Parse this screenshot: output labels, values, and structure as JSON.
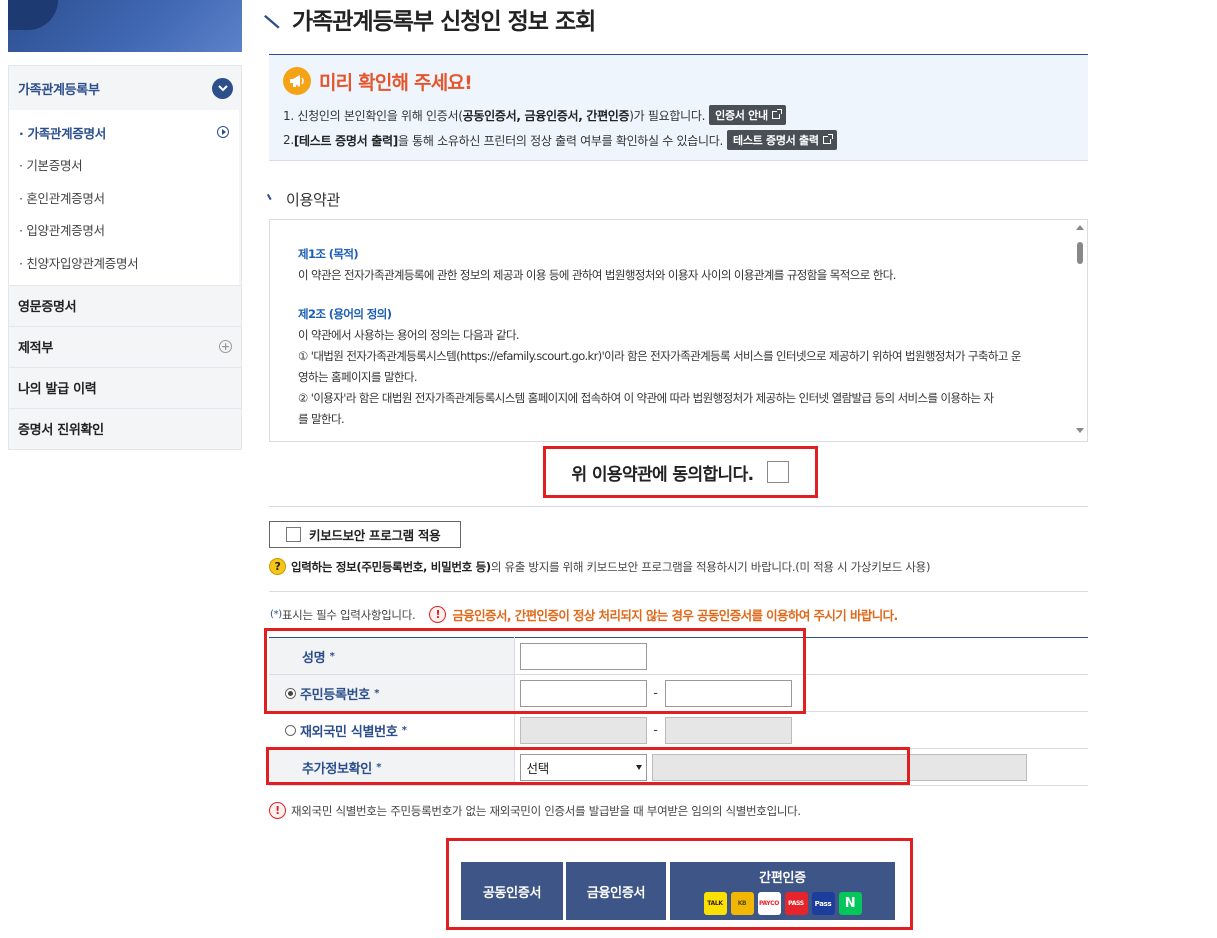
{
  "sidebar": {
    "section_title": "가족관계등록부",
    "sub_items": [
      {
        "label": "가족관계증명서"
      },
      {
        "label": "기본증명서"
      },
      {
        "label": "혼인관계증명서"
      },
      {
        "label": "입양관계증명서"
      },
      {
        "label": "친양자입양관계증명서"
      }
    ],
    "items": [
      {
        "label": "영문증명서"
      },
      {
        "label": "제적부"
      },
      {
        "label": "나의 발급 이력"
      },
      {
        "label": "증명서 진위확인"
      }
    ]
  },
  "page": {
    "title": "가족관계등록부 신청인 정보 조회"
  },
  "notice": {
    "title": "미리 확인해 주세요!",
    "line1_pre": "1. 신청인의 본인확인을 위해 인증서(",
    "line1_bold": "공동인증서, 금융인증서, 간편인증",
    "line1_post": ")가 필요합니다.",
    "line1_button": "인증서 안내",
    "line2_pre": "2. ",
    "line2_bold": "[테스트 증명서 출력]",
    "line2_post": "을 통해 소유하신 프린터의 정상 출력 여부를 확인하실 수 있습니다.",
    "line2_button": "테스트 증명서 출력"
  },
  "terms": {
    "section_label": "이용약관",
    "article1_title": "제1조 (목적)",
    "article1_body": "이 약관은 전자가족관계등록에 관한 정보의 제공과 이용 등에 관하여 법원행정처와 이용자 사이의 이용관계를 규정함을 목적으로 한다.",
    "article2_title": "제2조 (용어의 정의)",
    "article2_intro": "이 약관에서 사용하는 용어의 정의는 다음과 같다.",
    "article2_item1a": "① '대법원 전자가족관계등록시스템(https://efamily.scourt.go.kr)'이라 함은 전자가족관계등록 서비스를 인터넷으로 제공하기 위하여 법원행정처가 구축하고 운",
    "article2_item1b": "영하는 홈페이지를 말한다.",
    "article2_item2a": "② '이용자'라 함은 대법원 전자가족관계등록시스템 홈페이지에 접속하여 이 약관에 따라 법원행정처가 제공하는 인터넷 열람발급 등의 서비스를 이용하는 자",
    "article2_item2b": "를 말한다.",
    "agree_label": "위 이용약관에 동의합니다."
  },
  "keyboard": {
    "button_label": "키보드보안 프로그램 적용",
    "info_bold": "입력하는 정보(주민등록번호, 비밀번호 등)",
    "info_post": "의 유출 방지를 위해 키보드보안 프로그램을 적용하시기 바랍니다.(미 적용 시 가상키보드 사용)"
  },
  "form": {
    "required_note_mark": "(*)",
    "required_note": "표시는 필수 입력사항입니다.",
    "warning": "금융인증서, 간편인증이 정상 처리되지 않는 경우 공동인증서를 이용하여 주시기 바랍니다.",
    "required_star": "*",
    "name_label": "성명",
    "rrn_label": "주민등록번호",
    "foreign_label": "재외국민 식별번호",
    "extra_label": "추가정보확인",
    "extra_select_value": "선택",
    "dash": "-",
    "footnote": "재외국민 식별번호는 주민등록번호가 없는 재외국민이 인증서를 발급받을 때 부여받은 임의의 식별번호입니다."
  },
  "auth": {
    "joint_cert": "공동인증서",
    "financial_cert": "금융인증서",
    "simple_auth": "간편인증",
    "logos": [
      {
        "name": "kakao",
        "text": "TALK",
        "bg": "#fae100",
        "fg": "#3a1d1d"
      },
      {
        "name": "kb",
        "text": "KB",
        "bg": "#f2b705",
        "fg": "#5a4a00"
      },
      {
        "name": "payco",
        "text": "PAYCO",
        "bg": "#ffffff",
        "fg": "#e8242b"
      },
      {
        "name": "pass",
        "text": "PASS",
        "bg": "#e8242b",
        "fg": "#ffffff"
      },
      {
        "name": "samsung-pass",
        "text": "Pass",
        "bg": "#1c3d9c",
        "fg": "#ffffff"
      },
      {
        "name": "naver",
        "text": "N",
        "bg": "#03c75a",
        "fg": "#ffffff"
      }
    ]
  },
  "colors": {
    "brand": "#2c4f8c",
    "button": "#3d5587",
    "highlight": "#e02020",
    "warning_text": "#e06a1b"
  }
}
